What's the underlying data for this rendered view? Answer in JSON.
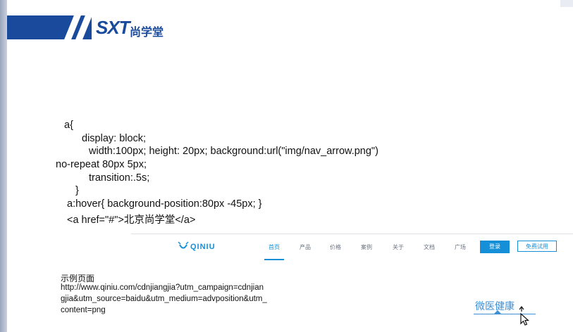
{
  "brand": {
    "logo_text": "SXT",
    "logo_cn": "尚学堂"
  },
  "code": {
    "lines": [
      "a{",
      "display: block;",
      "width:100px; height: 20px; background:url(\"img/nav_arrow.png\")",
      "no-repeat 80px 5px;",
      "transition:.5s;",
      "}",
      "a:hover{ background-position:80px -45px; }",
      "<a href=\"#\">北京尚学堂</a>"
    ]
  },
  "example_site": {
    "logo_text": "QINIU",
    "nav_items": [
      "首页",
      "产品",
      "价格",
      "案例",
      "关于",
      "文档",
      "广场"
    ],
    "active_item": "首页",
    "login_label": "登录",
    "trial_label": "免费试用",
    "accent_color": "#1590d8"
  },
  "example": {
    "title": "示例页面",
    "url_lines": [
      "http://www.qiniu.com/cdnjiangjia?utm_campaign=cdnjian",
      "gjia&utm_source=baidu&utm_medium=advposition&utm_",
      "content=png"
    ]
  },
  "demo": {
    "link_text": "微医健康",
    "color": "#3d8fd6"
  },
  "icons": {
    "cursor": "hand-pointer-cursor-icon",
    "qiniu": "qiniu-logo-icon",
    "arrow": "up-arrow-icon"
  }
}
